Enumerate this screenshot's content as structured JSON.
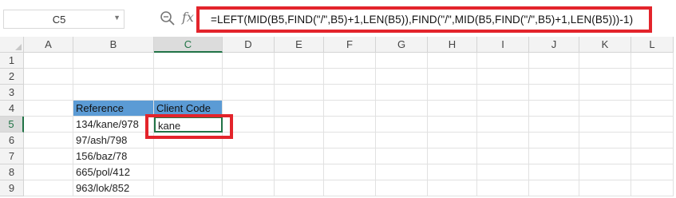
{
  "name_box": {
    "value": "C5"
  },
  "formula_bar": {
    "fx": "fx",
    "formula": "=LEFT(MID(B5,FIND(\"/\",B5)+1,LEN(B5)),FIND(\"/\",MID(B5,FIND(\"/\",B5)+1,LEN(B5)))-1)"
  },
  "columns": [
    "A",
    "B",
    "C",
    "D",
    "E",
    "F",
    "G",
    "H",
    "I",
    "J",
    "K",
    "L"
  ],
  "rows": [
    "1",
    "2",
    "3",
    "4",
    "5",
    "6",
    "7",
    "8",
    "9"
  ],
  "selected": {
    "column": "C",
    "row": "5"
  },
  "cells": {
    "B4": "Reference",
    "C4": "Client Code",
    "B5": "134/kane/978",
    "C5": "kane",
    "B6": "97/ash/798",
    "B7": "156/baz/78",
    "B8": "665/pol/412",
    "B9": "963/lok/852"
  },
  "colors": {
    "header_fill": "#5b9bd5",
    "selection": "#217346",
    "highlight": "#e3242b"
  }
}
